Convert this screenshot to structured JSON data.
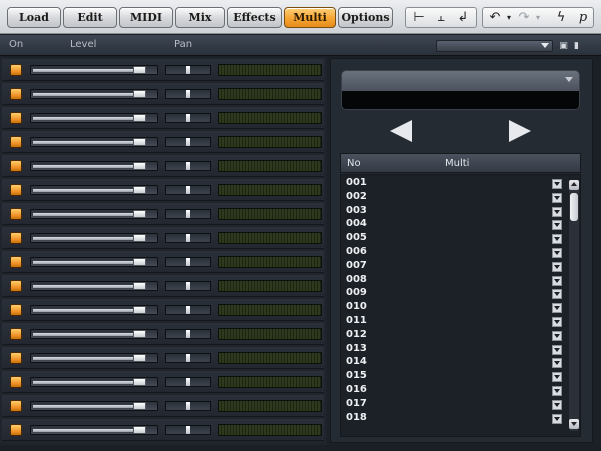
{
  "tabs": [
    {
      "label": "Load",
      "active": false
    },
    {
      "label": "Edit",
      "active": false
    },
    {
      "label": "MIDI",
      "active": false
    },
    {
      "label": "Mix",
      "active": false
    },
    {
      "label": "Effects",
      "active": false
    },
    {
      "label": "Multi",
      "active": true
    },
    {
      "label": "Options",
      "active": false
    }
  ],
  "toolbar_icons": [
    "split-icon",
    "merge-icon",
    "midi-plug-icon",
    "undo-icon",
    "redo-icon",
    "lightning-icon",
    "p-icon"
  ],
  "header": {
    "on_label": "On",
    "level_label": "Level",
    "pan_label": "Pan",
    "preset_value": ""
  },
  "channels": [
    {
      "on": true,
      "level": 0.92,
      "pan": 0.5
    },
    {
      "on": true,
      "level": 0.92,
      "pan": 0.5
    },
    {
      "on": true,
      "level": 0.92,
      "pan": 0.5
    },
    {
      "on": true,
      "level": 0.92,
      "pan": 0.5
    },
    {
      "on": true,
      "level": 0.92,
      "pan": 0.5
    },
    {
      "on": true,
      "level": 0.92,
      "pan": 0.5
    },
    {
      "on": true,
      "level": 0.92,
      "pan": 0.5
    },
    {
      "on": true,
      "level": 0.92,
      "pan": 0.5
    },
    {
      "on": true,
      "level": 0.92,
      "pan": 0.5
    },
    {
      "on": true,
      "level": 0.92,
      "pan": 0.5
    },
    {
      "on": true,
      "level": 0.92,
      "pan": 0.5
    },
    {
      "on": true,
      "level": 0.92,
      "pan": 0.5
    },
    {
      "on": true,
      "level": 0.92,
      "pan": 0.5
    },
    {
      "on": true,
      "level": 0.92,
      "pan": 0.5
    },
    {
      "on": true,
      "level": 0.92,
      "pan": 0.5
    },
    {
      "on": true,
      "level": 0.92,
      "pan": 0.5
    }
  ],
  "multi_panel": {
    "selected_multi": "",
    "list_header_no": "No",
    "list_header_multi": "Multi",
    "items": [
      "001",
      "002",
      "003",
      "004",
      "005",
      "006",
      "007",
      "008",
      "009",
      "010",
      "011",
      "012",
      "013",
      "014",
      "015",
      "016",
      "017",
      "018"
    ]
  },
  "colors": {
    "accent": "#f6a433",
    "background": "#1b1f26",
    "meter": "#2d3a1e"
  }
}
